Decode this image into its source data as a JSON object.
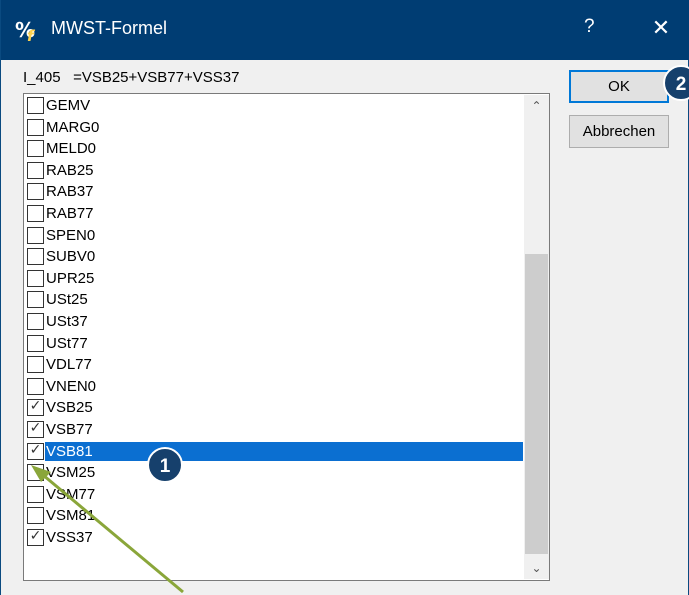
{
  "window": {
    "title": "MWST-Formel",
    "help_label": "?",
    "close_label": "✕",
    "app_icon": "formula-icon"
  },
  "formula": {
    "name": "I_405",
    "expression": "=VSB25+VSB77+VSS37"
  },
  "list": {
    "items": [
      {
        "label": "GEMV",
        "checked": false
      },
      {
        "label": "MARG0",
        "checked": false
      },
      {
        "label": "MELD0",
        "checked": false
      },
      {
        "label": "RAB25",
        "checked": false
      },
      {
        "label": "RAB37",
        "checked": false
      },
      {
        "label": "RAB77",
        "checked": false
      },
      {
        "label": "SPEN0",
        "checked": false
      },
      {
        "label": "SUBV0",
        "checked": false
      },
      {
        "label": "UPR25",
        "checked": false
      },
      {
        "label": "USt25",
        "checked": false
      },
      {
        "label": "USt37",
        "checked": false
      },
      {
        "label": "USt77",
        "checked": false
      },
      {
        "label": "VDL77",
        "checked": false
      },
      {
        "label": "VNEN0",
        "checked": false
      },
      {
        "label": "VSB25",
        "checked": true
      },
      {
        "label": "VSB77",
        "checked": true
      },
      {
        "label": "VSB81",
        "checked": true,
        "selected": true
      },
      {
        "label": "VSM25",
        "checked": false
      },
      {
        "label": "VSM77",
        "checked": false
      },
      {
        "label": "VSM81",
        "checked": false
      },
      {
        "label": "VSS37",
        "checked": true
      }
    ],
    "check_glyph": "✓",
    "scroll_up_glyph": "⌃",
    "scroll_down_glyph": "⌄"
  },
  "buttons": {
    "ok_label": "OK",
    "cancel_label": "Abbrechen"
  },
  "annotations": {
    "badge_1": "1",
    "badge_2": "2",
    "badge_color": "#16406c",
    "arrow_color": "#8aa63a"
  },
  "colors": {
    "titlebar": "#003d73",
    "selection": "#0b6fd1"
  }
}
